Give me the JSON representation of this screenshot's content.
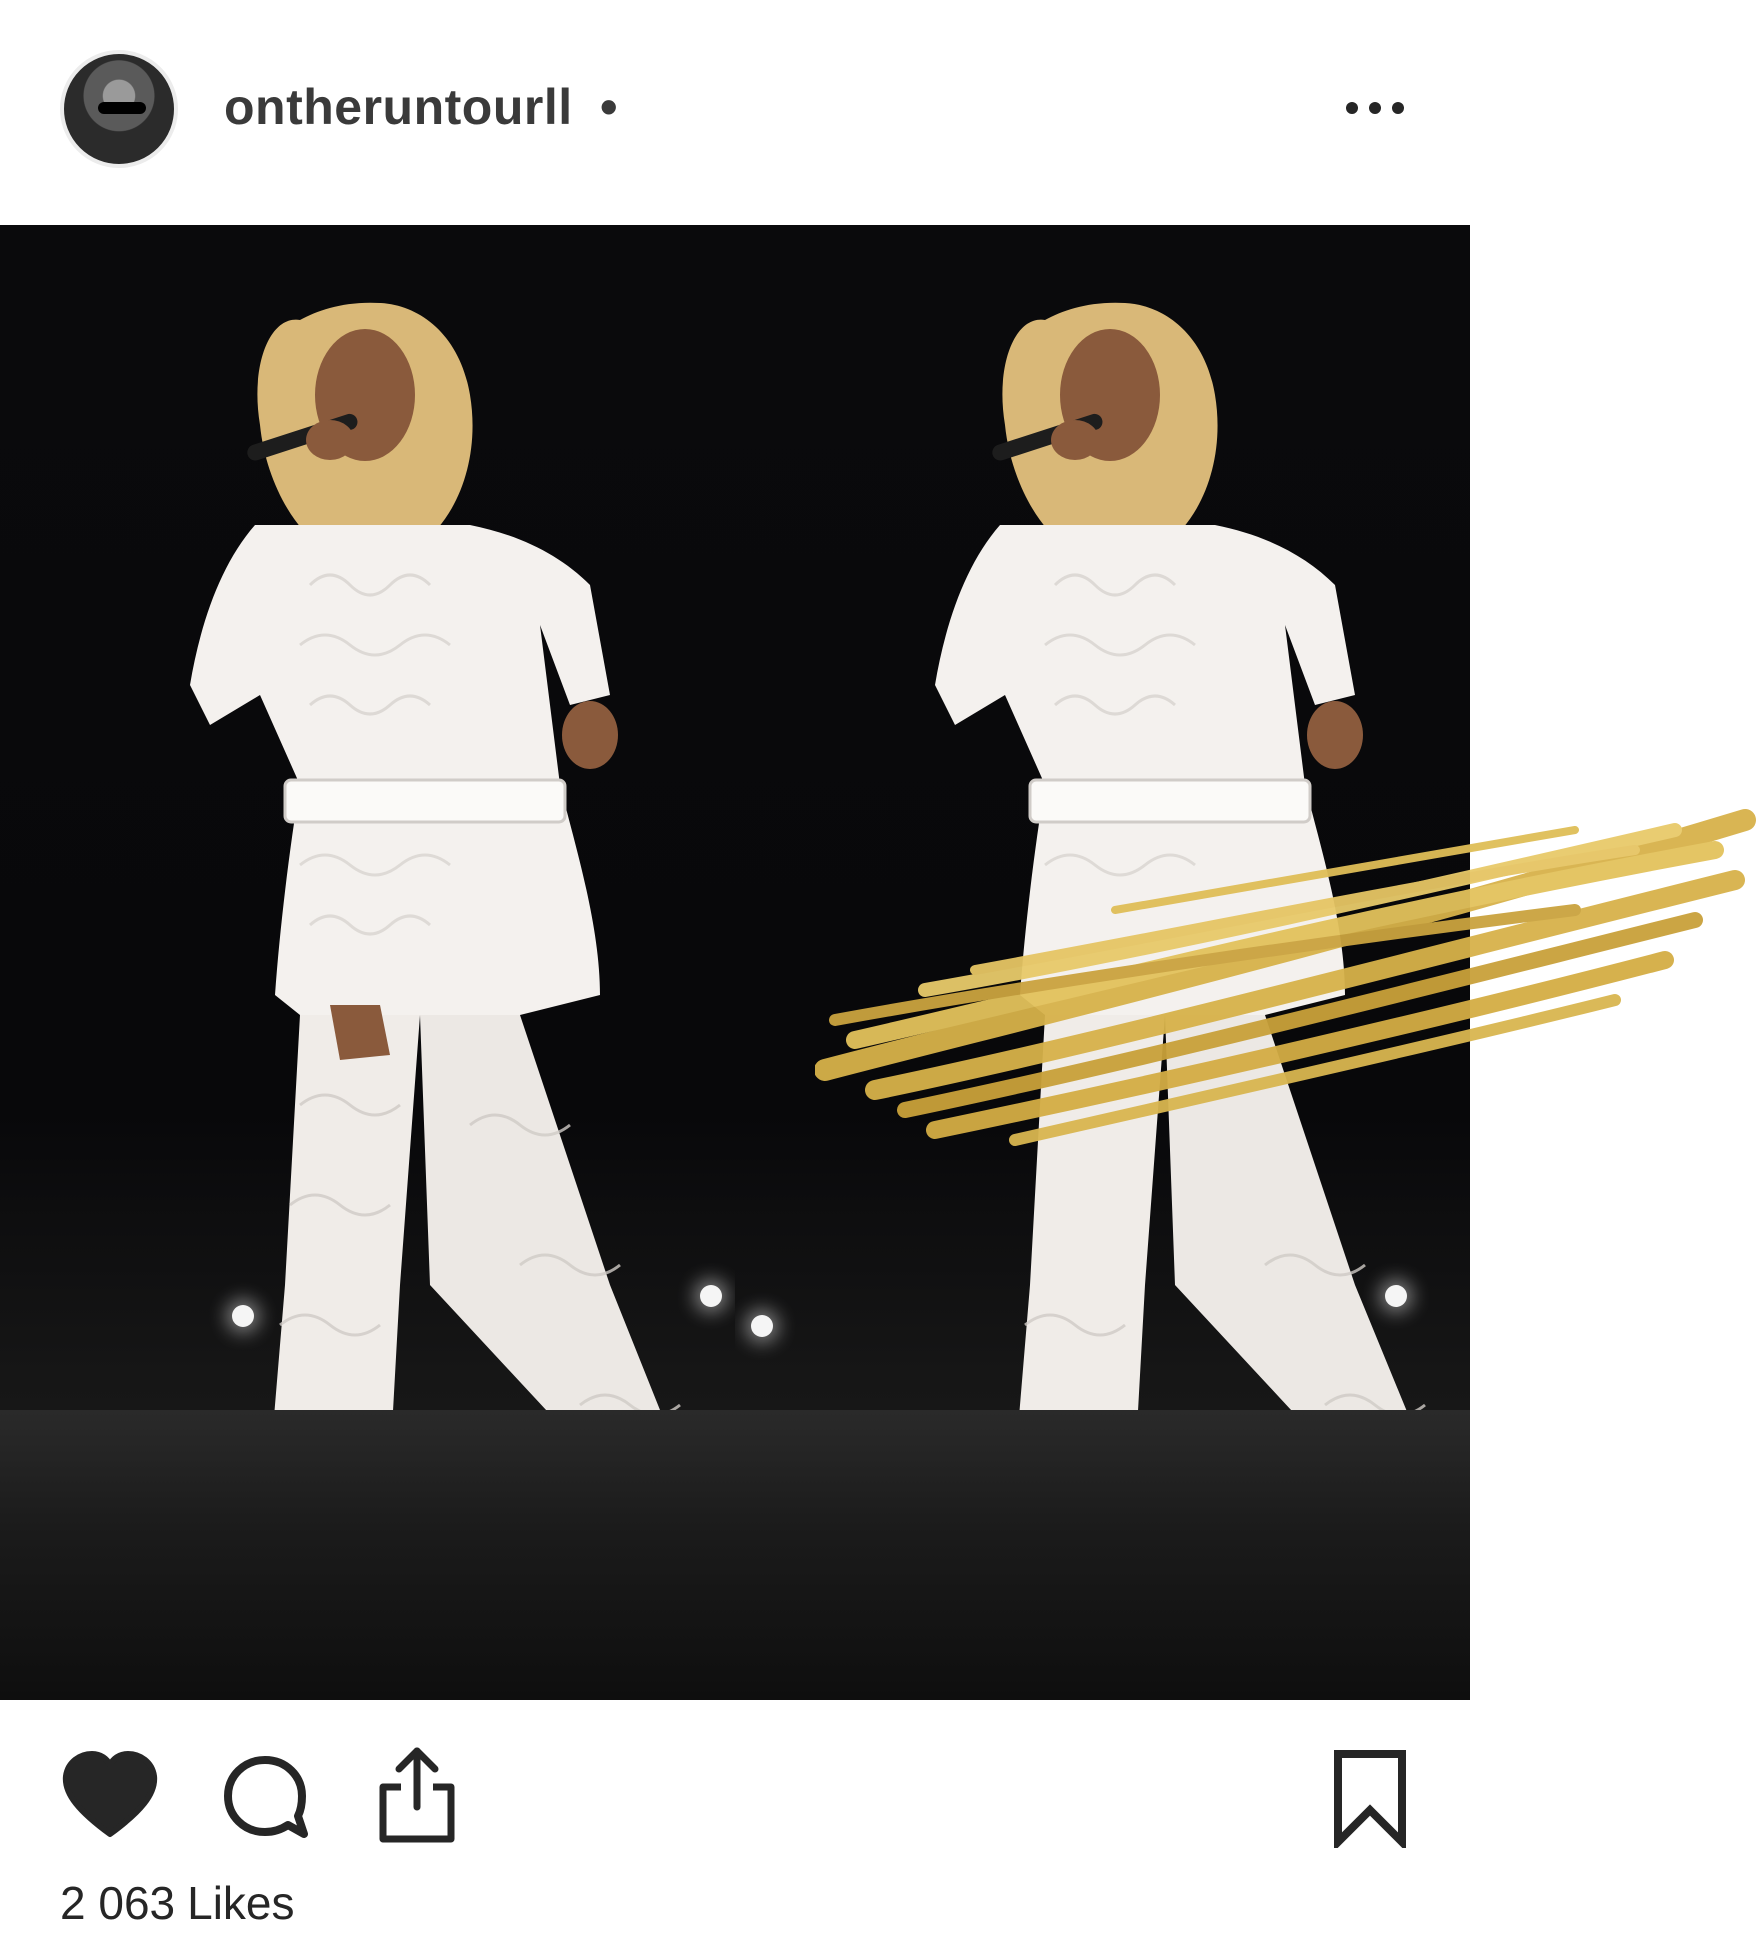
{
  "post": {
    "username": "ontheruntourll",
    "separator": "•",
    "more_icon": "more-horizontal-icon",
    "avatar_icon": "profile-avatar"
  },
  "photo": {
    "panels": 2,
    "performer_outfit_color": "#f4f1ee",
    "background_color": "#050505",
    "overlay": {
      "type": "gold-brush-stroke",
      "color": "#d7b24a"
    }
  },
  "actions": {
    "like_icon": "heart-filled-icon",
    "comment_icon": "comment-bubble-icon",
    "share_icon": "share-upload-icon",
    "save_icon": "bookmark-icon"
  },
  "likes": {
    "count": "2 063",
    "label": "Likes"
  }
}
